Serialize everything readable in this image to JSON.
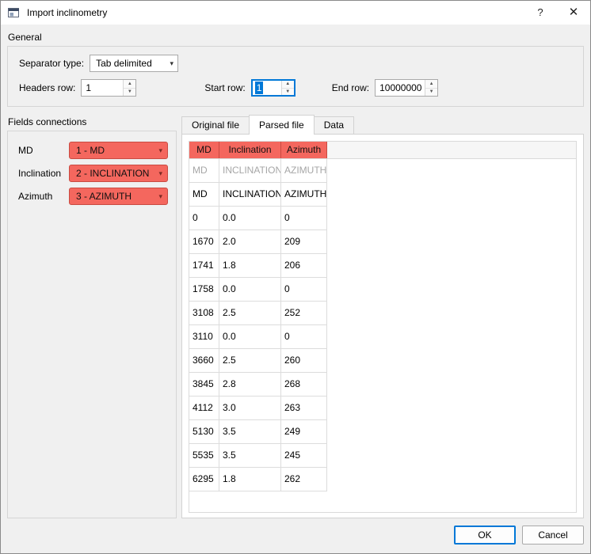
{
  "window": {
    "title": "Import inclinometry",
    "help_label": "?",
    "close_label": "✕"
  },
  "general": {
    "title": "General",
    "separator_label": "Separator type:",
    "separator_value": "Tab delimited",
    "headers_row_label": "Headers row:",
    "headers_row_value": "1",
    "start_row_label": "Start row:",
    "start_row_value": "1",
    "end_row_label": "End row:",
    "end_row_value": "10000000"
  },
  "fields": {
    "title": "Fields connections",
    "items": [
      {
        "label": "MD",
        "value": "1 - MD"
      },
      {
        "label": "Inclination",
        "value": "2 - INCLINATION"
      },
      {
        "label": "Azimuth",
        "value": "3 - AZIMUTH"
      }
    ]
  },
  "tabs": [
    {
      "label": "Original file",
      "active": false
    },
    {
      "label": "Parsed file",
      "active": true
    },
    {
      "label": "Data",
      "active": false
    }
  ],
  "table": {
    "headers": [
      "MD",
      "Inclination",
      "Azimuth"
    ],
    "rows": [
      {
        "cells": [
          "MD",
          "INCLINATION",
          "AZIMUTH"
        ],
        "muted": true
      },
      {
        "cells": [
          "MD",
          "INCLINATION",
          "AZIMUTH"
        ],
        "muted": false
      },
      {
        "cells": [
          "0",
          "0.0",
          "0"
        ],
        "muted": false
      },
      {
        "cells": [
          "1670",
          "2.0",
          "209"
        ],
        "muted": false
      },
      {
        "cells": [
          "1741",
          "1.8",
          "206"
        ],
        "muted": false
      },
      {
        "cells": [
          "1758",
          "0.0",
          "0"
        ],
        "muted": false
      },
      {
        "cells": [
          "3108",
          "2.5",
          "252"
        ],
        "muted": false
      },
      {
        "cells": [
          "3110",
          "0.0",
          "0"
        ],
        "muted": false
      },
      {
        "cells": [
          "3660",
          "2.5",
          "260"
        ],
        "muted": false
      },
      {
        "cells": [
          "3845",
          "2.8",
          "268"
        ],
        "muted": false
      },
      {
        "cells": [
          "4112",
          "3.0",
          "263"
        ],
        "muted": false
      },
      {
        "cells": [
          "5130",
          "3.5",
          "249"
        ],
        "muted": false
      },
      {
        "cells": [
          "5535",
          "3.5",
          "245"
        ],
        "muted": false
      },
      {
        "cells": [
          "6295",
          "1.8",
          "262"
        ],
        "muted": false
      }
    ]
  },
  "footer": {
    "ok_label": "OK",
    "cancel_label": "Cancel"
  },
  "colors": {
    "accent_red": "#f4675e",
    "accent_red_border": "#c94b42",
    "accent_red_dark": "#7c2a24",
    "focus_blue": "#0078d7",
    "selection_blue": "#0078d7"
  }
}
